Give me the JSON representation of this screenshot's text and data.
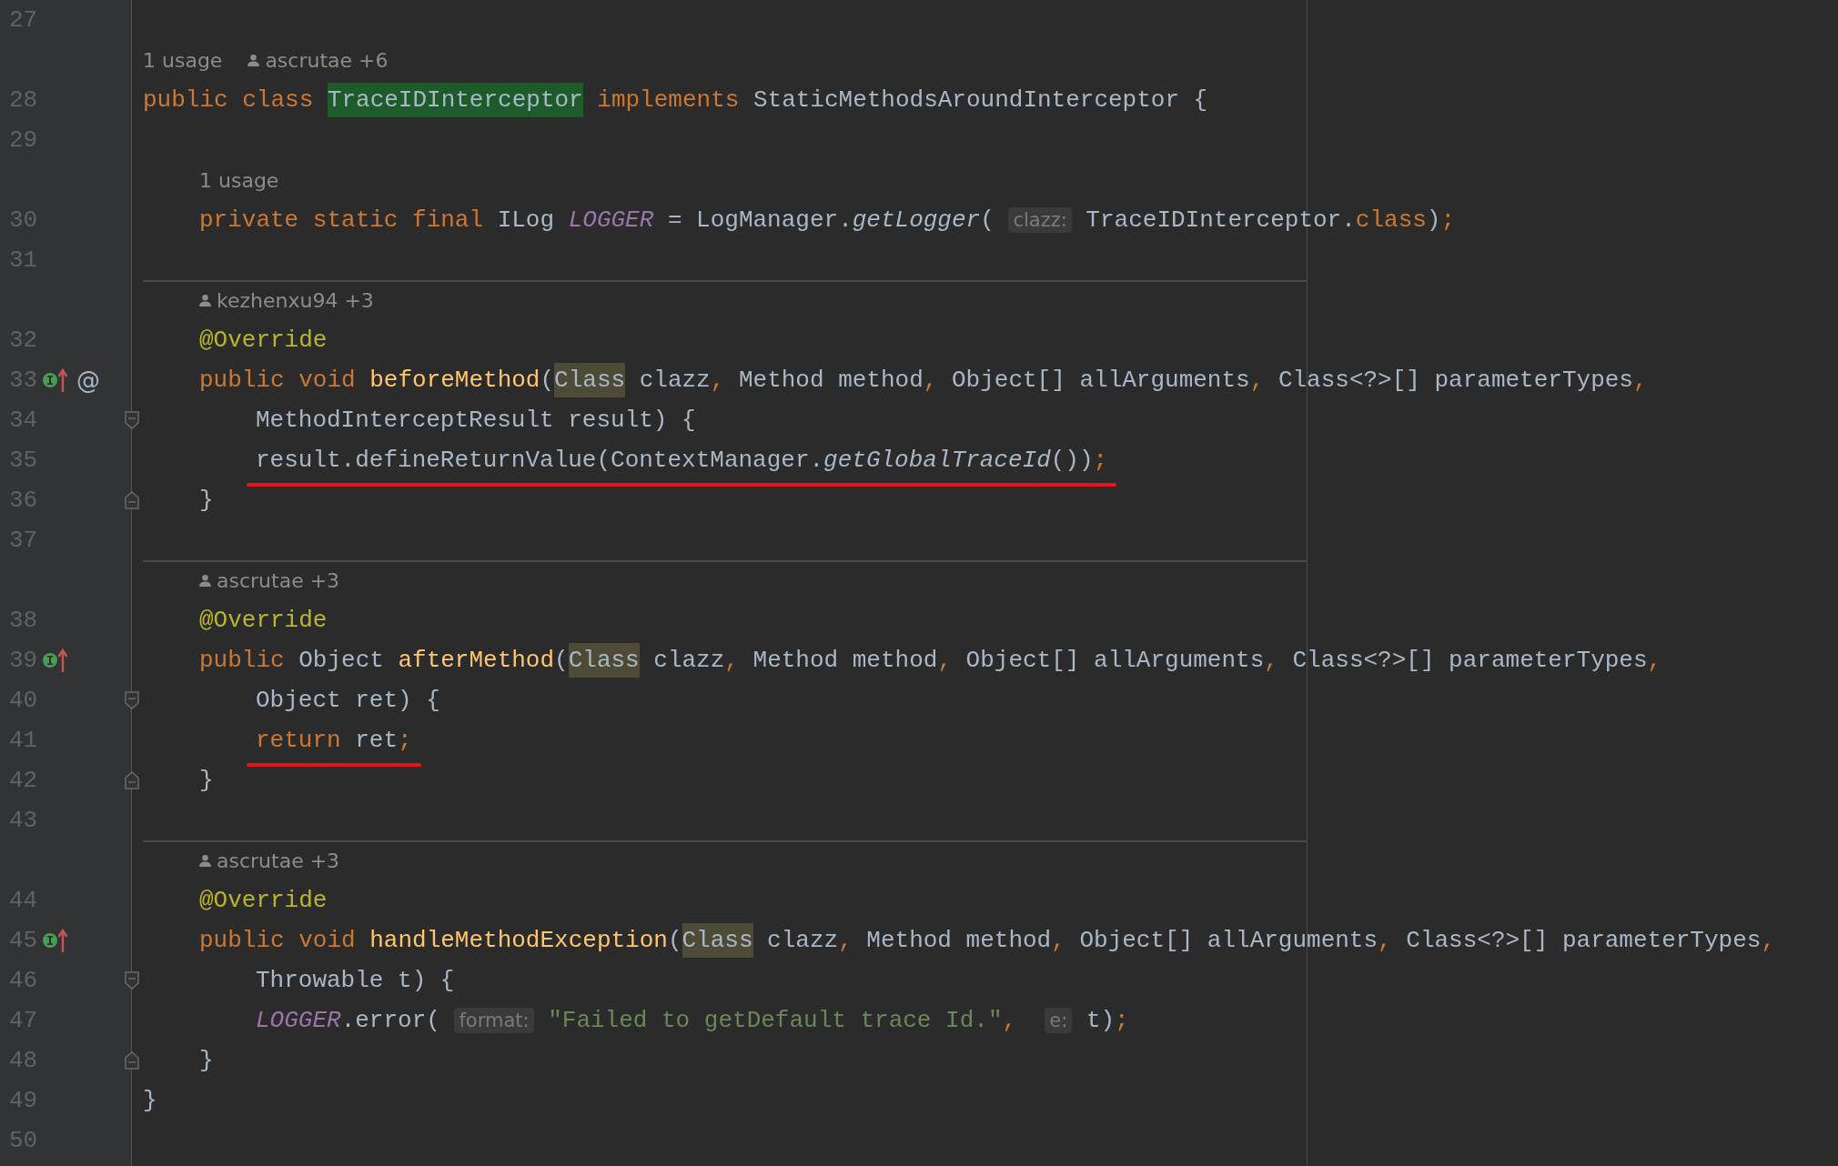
{
  "editor": {
    "rows": [
      {
        "kind": "code",
        "line": "27"
      },
      {
        "kind": "lens",
        "separator": false,
        "items": [
          {
            "kind": "usage",
            "text": "1 usage"
          },
          {
            "kind": "author",
            "text": "ascrutae +6"
          }
        ]
      },
      {
        "kind": "code",
        "line": "28",
        "tokens": [
          {
            "kind": "kw",
            "t": "public class "
          },
          {
            "kind": "match",
            "t": "TraceIDInterceptor"
          },
          {
            "kind": "kw",
            "t": " implements "
          },
          {
            "kind": "plain",
            "t": "StaticMethodsAroundInterceptor {"
          }
        ],
        "children": [
          {
            "kind": "code",
            "line": "29"
          },
          {
            "kind": "lens",
            "separator": false,
            "items": [
              {
                "kind": "usage",
                "text": "1 usage"
              }
            ]
          },
          {
            "kind": "code",
            "line": "30",
            "tokens": [
              {
                "kind": "kw",
                "t": "private static final "
              },
              {
                "kind": "plain",
                "t": "ILog "
              },
              {
                "kind": "static",
                "t": "LOGGER"
              },
              {
                "kind": "plain",
                "t": " = LogManager."
              },
              {
                "kind": "call",
                "t": "getLogger"
              },
              {
                "kind": "plain",
                "t": "( "
              },
              {
                "kind": "hint",
                "t": "clazz:"
              },
              {
                "kind": "plain",
                "t": " TraceIDInterceptor."
              },
              {
                "kind": "kw",
                "t": "class"
              },
              {
                "kind": "plain",
                "t": ")"
              },
              {
                "kind": "kw",
                "t": ";"
              }
            ]
          },
          {
            "kind": "code",
            "line": "31"
          },
          {
            "kind": "lens",
            "separator": true,
            "items": [
              {
                "kind": "author",
                "text": "kezhenxu94 +3"
              }
            ]
          },
          {
            "kind": "code",
            "line": "32",
            "tokens": [
              {
                "kind": "ann",
                "t": "@Override"
              }
            ]
          },
          {
            "kind": "code",
            "line": "33",
            "markers": [
              {
                "kind": "implements"
              },
              {
                "kind": "glyph",
                "text": "@"
              }
            ],
            "tokens": [
              {
                "kind": "kw",
                "t": "public void "
              },
              {
                "kind": "fn",
                "t": "beforeMethod"
              },
              {
                "kind": "plain",
                "t": "("
              },
              {
                "kind": "usage",
                "t": "Class"
              },
              {
                "kind": "plain",
                "t": " clazz"
              },
              {
                "kind": "kw",
                "t": ", "
              },
              {
                "kind": "plain",
                "t": "Method method"
              },
              {
                "kind": "kw",
                "t": ", "
              },
              {
                "kind": "plain",
                "t": "Object[] allArguments"
              },
              {
                "kind": "kw",
                "t": ", "
              },
              {
                "kind": "plain",
                "t": "Class<?>[] parameterTypes"
              },
              {
                "kind": "kw",
                "t": ","
              }
            ],
            "children": [
              {
                "kind": "code",
                "line": "34",
                "markers": [
                  {
                    "kind": "fold-start"
                  }
                ],
                "tokens": [
                  {
                    "kind": "plain",
                    "t": "MethodInterceptResult result) {"
                  }
                ]
              },
              {
                "kind": "code",
                "line": "35",
                "underlined": true,
                "tokens": [
                  {
                    "kind": "plain",
                    "t": "result.defineReturnValue(ContextManager."
                  },
                  {
                    "kind": "call",
                    "t": "getGlobalTraceId"
                  },
                  {
                    "kind": "plain",
                    "t": "())"
                  },
                  {
                    "kind": "kw",
                    "t": ";"
                  }
                ]
              }
            ]
          },
          {
            "kind": "code",
            "line": "36",
            "markers": [
              {
                "kind": "fold-end"
              }
            ],
            "tokens": [
              {
                "kind": "plain",
                "t": "}"
              }
            ]
          },
          {
            "kind": "code",
            "line": "37"
          },
          {
            "kind": "lens",
            "separator": true,
            "items": [
              {
                "kind": "author",
                "text": "ascrutae +3"
              }
            ]
          },
          {
            "kind": "code",
            "line": "38",
            "tokens": [
              {
                "kind": "ann",
                "t": "@Override"
              }
            ]
          },
          {
            "kind": "code",
            "line": "39",
            "markers": [
              {
                "kind": "implements"
              }
            ],
            "tokens": [
              {
                "kind": "kw",
                "t": "public "
              },
              {
                "kind": "plain",
                "t": "Object "
              },
              {
                "kind": "fn",
                "t": "afterMethod"
              },
              {
                "kind": "plain",
                "t": "("
              },
              {
                "kind": "usage",
                "t": "Class"
              },
              {
                "kind": "plain",
                "t": " clazz"
              },
              {
                "kind": "kw",
                "t": ", "
              },
              {
                "kind": "plain",
                "t": "Method method"
              },
              {
                "kind": "kw",
                "t": ", "
              },
              {
                "kind": "plain",
                "t": "Object[] allArguments"
              },
              {
                "kind": "kw",
                "t": ", "
              },
              {
                "kind": "plain",
                "t": "Class<?>[] parameterTypes"
              },
              {
                "kind": "kw",
                "t": ","
              }
            ],
            "children": [
              {
                "kind": "code",
                "line": "40",
                "markers": [
                  {
                    "kind": "fold-start"
                  }
                ],
                "tokens": [
                  {
                    "kind": "plain",
                    "t": "Object ret) {"
                  }
                ]
              },
              {
                "kind": "code",
                "line": "41",
                "underlined": true,
                "tokens": [
                  {
                    "kind": "kw",
                    "t": "return "
                  },
                  {
                    "kind": "plain",
                    "t": "ret"
                  },
                  {
                    "kind": "kw",
                    "t": ";"
                  }
                ]
              }
            ]
          },
          {
            "kind": "code",
            "line": "42",
            "markers": [
              {
                "kind": "fold-end"
              }
            ],
            "tokens": [
              {
                "kind": "plain",
                "t": "}"
              }
            ]
          },
          {
            "kind": "code",
            "line": "43"
          },
          {
            "kind": "lens",
            "separator": true,
            "items": [
              {
                "kind": "author",
                "text": "ascrutae +3"
              }
            ]
          },
          {
            "kind": "code",
            "line": "44",
            "tokens": [
              {
                "kind": "ann",
                "t": "@Override"
              }
            ]
          },
          {
            "kind": "code",
            "line": "45",
            "markers": [
              {
                "kind": "implements"
              }
            ],
            "tokens": [
              {
                "kind": "kw",
                "t": "public void "
              },
              {
                "kind": "fn",
                "t": "handleMethodException"
              },
              {
                "kind": "plain",
                "t": "("
              },
              {
                "kind": "usage",
                "t": "Class"
              },
              {
                "kind": "plain",
                "t": " clazz"
              },
              {
                "kind": "kw",
                "t": ", "
              },
              {
                "kind": "plain",
                "t": "Method method"
              },
              {
                "kind": "kw",
                "t": ", "
              },
              {
                "kind": "plain",
                "t": "Object[] allArguments"
              },
              {
                "kind": "kw",
                "t": ", "
              },
              {
                "kind": "plain",
                "t": "Class<?>[] parameterTypes"
              },
              {
                "kind": "kw",
                "t": ","
              }
            ],
            "children": [
              {
                "kind": "code",
                "line": "46",
                "markers": [
                  {
                    "kind": "fold-start"
                  }
                ],
                "tokens": [
                  {
                    "kind": "plain",
                    "t": "Throwable t) {"
                  }
                ]
              },
              {
                "kind": "code",
                "line": "47",
                "tokens": [
                  {
                    "kind": "static",
                    "t": "LOGGER"
                  },
                  {
                    "kind": "plain",
                    "t": ".error( "
                  },
                  {
                    "kind": "hint",
                    "t": "format:"
                  },
                  {
                    "kind": "string",
                    "t": " \"Failed to getDefault trace Id.\""
                  },
                  {
                    "kind": "kw",
                    "t": ",  "
                  },
                  {
                    "kind": "hint",
                    "t": "e:"
                  },
                  {
                    "kind": "plain",
                    "t": " t)"
                  },
                  {
                    "kind": "kw",
                    "t": ";"
                  }
                ]
              }
            ]
          },
          {
            "kind": "code",
            "line": "48",
            "markers": [
              {
                "kind": "fold-end"
              }
            ],
            "tokens": [
              {
                "kind": "plain",
                "t": "}"
              }
            ]
          }
        ]
      },
      {
        "kind": "code",
        "line": "49",
        "tokens": [
          {
            "kind": "plain",
            "t": "}"
          }
        ]
      },
      {
        "kind": "code",
        "line": "50"
      }
    ]
  }
}
